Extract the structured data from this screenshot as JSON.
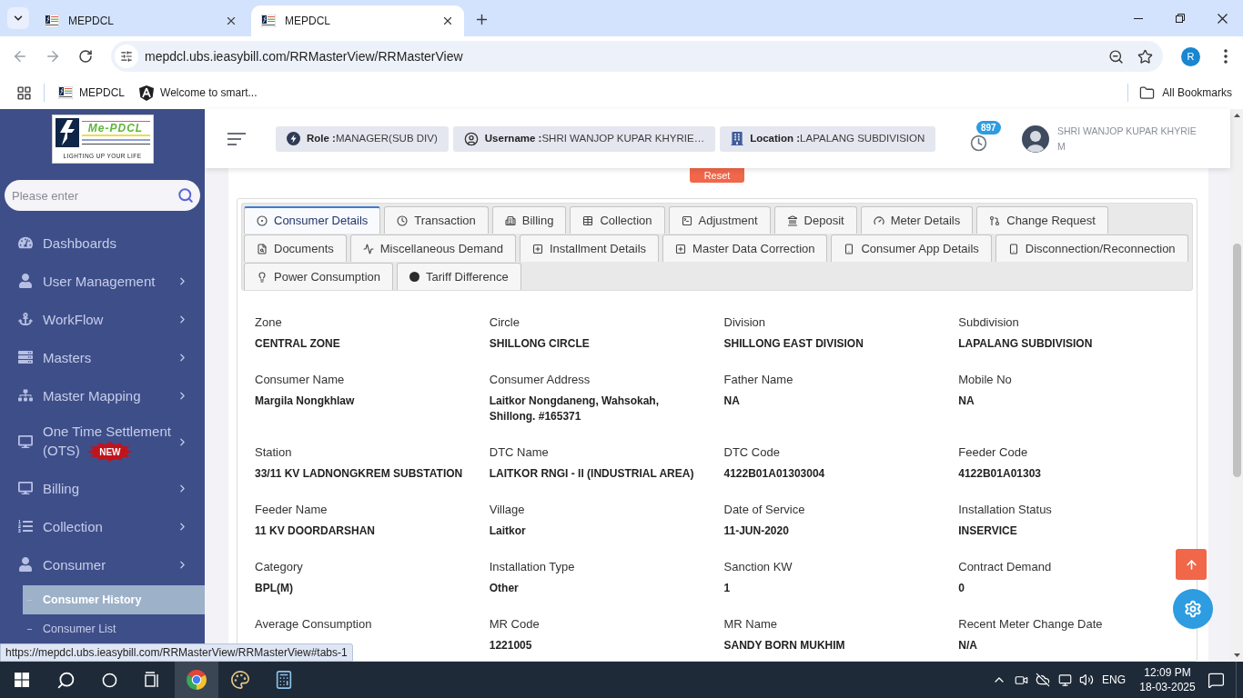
{
  "browser": {
    "tabs": [
      {
        "title": "MEPDCL",
        "selected": false
      },
      {
        "title": "MEPDCL",
        "selected": true
      }
    ],
    "address": "mepdcl.ubs.ieasybill.com/RRMasterView/RRMasterView",
    "profile_initial": "R",
    "bookmarks": [
      {
        "kind": "site",
        "title": "MEPDCL"
      },
      {
        "kind": "angular",
        "title": "Welcome to smart..."
      }
    ],
    "all_bookmarks": "All Bookmarks"
  },
  "sidebar": {
    "logo": {
      "name": "Me-PDCL",
      "tagline": "LIGHTING UP YOUR LIFE"
    },
    "search": {
      "placeholder": "Please enter"
    },
    "items": [
      {
        "kind": "dashboard",
        "label": "Dashboards",
        "has_submenu": false
      },
      {
        "kind": "user",
        "label": "User Management",
        "has_submenu": true
      },
      {
        "kind": "workflow",
        "label": "WorkFlow",
        "has_submenu": true
      },
      {
        "kind": "masters",
        "label": "Masters",
        "has_submenu": true
      },
      {
        "kind": "mapping",
        "label": "Master Mapping",
        "has_submenu": true
      },
      {
        "kind": "ots",
        "label": "One Time Settlement (OTS)",
        "badge": "NEW",
        "has_submenu": true
      },
      {
        "kind": "billing",
        "label": "Billing",
        "has_submenu": true
      },
      {
        "kind": "collection",
        "label": "Collection",
        "has_submenu": true
      },
      {
        "kind": "consumer",
        "label": "Consumer",
        "has_submenu": true,
        "children": [
          {
            "label": "Consumer History",
            "selected": true
          },
          {
            "label": "Consumer List",
            "selected": false
          }
        ]
      }
    ]
  },
  "header": {
    "info": [
      {
        "kind": "role",
        "text": "**Role :**MANAGER(SUB DIV)"
      },
      {
        "kind": "username",
        "text": "**Username :**SHRI WANJOP KUPAR KHYRIE…"
      },
      {
        "kind": "location",
        "text": "**Location :**LAPALANG SUBDIVISION"
      }
    ],
    "notification_count": "897",
    "user_name": "SHRI WANJOP KUPAR KHYRIE M"
  },
  "content": {
    "reset_button": "Reset",
    "tab_rows": [
      [
        {
          "label": "Consumer Details",
          "selected": true
        },
        {
          "label": "Transaction",
          "selected": false
        },
        {
          "label": "Billing",
          "selected": false
        },
        {
          "label": "Collection",
          "selected": false
        },
        {
          "label": "Adjustment",
          "selected": false
        },
        {
          "label": "Deposit",
          "selected": false
        },
        {
          "label": "Meter Details",
          "selected": false
        },
        {
          "label": "Change Request",
          "selected": false
        }
      ],
      [
        {
          "label": "Documents",
          "selected": false
        },
        {
          "label": "Miscellaneous Demand",
          "selected": false
        },
        {
          "label": "Installment Details",
          "selected": false
        },
        {
          "label": "Master Data Correction",
          "selected": false
        },
        {
          "label": "Consumer App Details",
          "selected": false
        },
        {
          "label": "Disconnection/Reconnection",
          "selected": false
        }
      ],
      [
        {
          "label": "Power Consumption",
          "selected": false
        },
        {
          "label": "Tariff Difference",
          "selected": false
        }
      ]
    ],
    "details": [
      {
        "label": "Zone",
        "value": "CENTRAL ZONE"
      },
      {
        "label": "Circle",
        "value": "SHILLONG CIRCLE"
      },
      {
        "label": "Division",
        "value": "SHILLONG EAST DIVISION"
      },
      {
        "label": "Subdivision",
        "value": "LAPALANG SUBDIVISION"
      },
      {
        "label": "Consumer Name",
        "value": "Margila Nongkhlaw"
      },
      {
        "label": "Consumer Address",
        "value": "Laitkor Nongdaneng, Wahsokah, Shillong. #165371"
      },
      {
        "label": "Father Name",
        "value": "NA"
      },
      {
        "label": "Mobile No",
        "value": "NA"
      },
      {
        "label": "Station",
        "value": "33/11 KV LADNONGKREM SUBSTATION"
      },
      {
        "label": "DTC Name",
        "value": "LAITKOR RNGI - II (INDUSTRIAL AREA)"
      },
      {
        "label": "DTC Code",
        "value": "4122B01A01303004"
      },
      {
        "label": "Feeder Code",
        "value": "4122B01A01303"
      },
      {
        "label": "Feeder Name",
        "value": "11 KV DOORDARSHAN"
      },
      {
        "label": "Village",
        "value": "Laitkor"
      },
      {
        "label": "Date of Service",
        "value": "11-JUN-2020"
      },
      {
        "label": "Installation Status",
        "value": "INSERVICE"
      },
      {
        "label": "Category",
        "value": "BPL(M)"
      },
      {
        "label": "Installation Type",
        "value": "Other"
      },
      {
        "label": "Sanction KW",
        "value": "1"
      },
      {
        "label": "Contract Demand",
        "value": "0"
      },
      {
        "label": "Average Consumption"
      },
      {
        "label": "MR Code",
        "value": "1221005"
      },
      {
        "label": "MR Name",
        "value": "SANDY BORN MUKHIM"
      },
      {
        "label": "Recent Meter Change Date",
        "value": "N/A"
      }
    ]
  },
  "status_url": "https://mepdcl.ubs.ieasybill.com/RRMasterView/RRMasterView#tabs-1",
  "taskbar": {
    "language": "ENG",
    "time": "12:09 PM",
    "date": "18-03-2025"
  }
}
